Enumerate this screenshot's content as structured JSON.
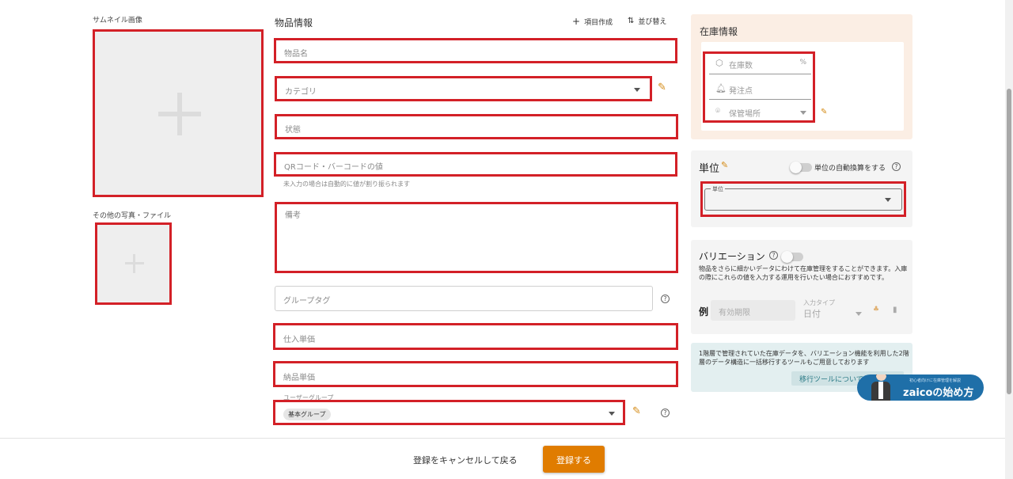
{
  "thumbnail": {
    "label": "サムネイル画像"
  },
  "other_files": {
    "label": "その他の写真・ファイル"
  },
  "item_info": {
    "title": "物品情報",
    "create_field_label": "項目作成",
    "sort_label": "並び替え"
  },
  "fields": {
    "name": "物品名",
    "category": "カテゴリ",
    "state": "状態",
    "barcode": "QRコード・バーコードの値",
    "barcode_hint": "未入力の場合は自動的に値が割り振られます",
    "notes": "備考",
    "group_tag": "グループタグ",
    "purchase_price": "仕入単価",
    "delivery_price": "納品単価",
    "user_group_label": "ユーザーグループ",
    "user_group_value": "基本グループ"
  },
  "stock": {
    "title": "在庫情報",
    "quantity": "在庫数",
    "reorder_point": "発注点",
    "location": "保管場所"
  },
  "unit": {
    "title": "単位",
    "auto_convert": "単位の自動換算をする",
    "field_label": "単位"
  },
  "variation": {
    "title": "バリエーション",
    "description": "物品をさらに細かいデータにわけて在庫管理をすることができます。入庫の際にこれらの値を入力する運用を行いたい場合におすすめです。",
    "example_label": "例",
    "example_placeholder": "有効期限",
    "input_type_label": "入力タイプ",
    "input_type_value": "日付"
  },
  "migration": {
    "text": "1階層で管理されていた在庫データを、バリエーション機能を利用した2階層のデータ構造に一括移行するツールもご用意しております",
    "button": "移行ツールについて"
  },
  "zaico_banner": {
    "small_text": "初心者向けに在庫管理を解説",
    "title": "zaicoの始め方"
  },
  "footer": {
    "cancel": "登録をキャンセルして戻る",
    "submit": "登録する"
  },
  "colors": {
    "accent_orange": "#e07c00",
    "highlight_red": "#d32027",
    "stock_bg": "#fbeee4",
    "banner_blue": "#1f6fa8"
  }
}
